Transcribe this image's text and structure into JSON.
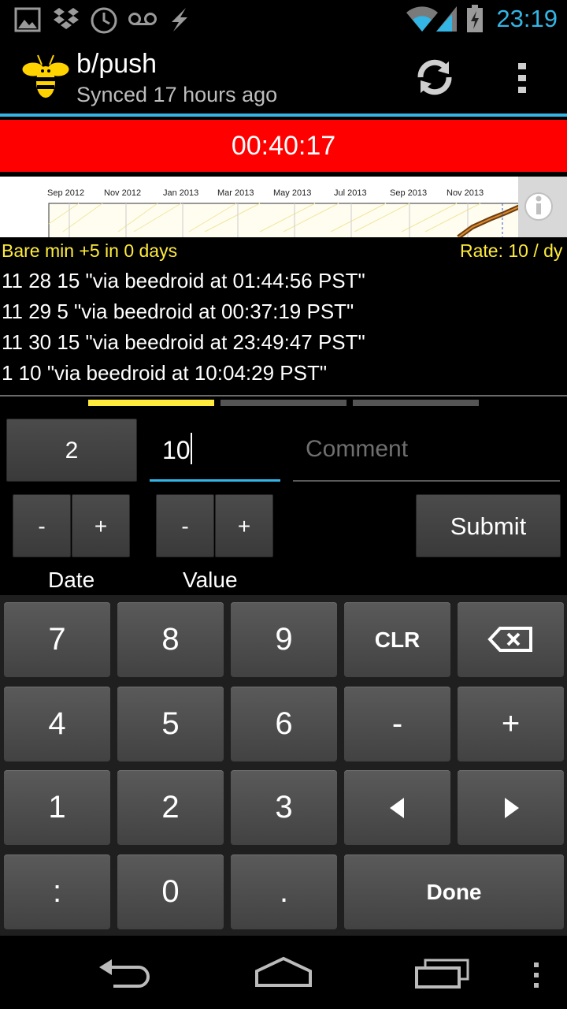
{
  "status_bar": {
    "time": "23:19",
    "icons": [
      "gallery-icon",
      "dropbox-icon",
      "clock-icon",
      "voicemail-icon",
      "lightning-icon",
      "wifi-icon",
      "signal-icon",
      "battery-icon"
    ]
  },
  "app_bar": {
    "title": "b/push",
    "subtitle": "Synced 17 hours ago",
    "icons": [
      "bee-logo-icon",
      "sync-icon",
      "overflow-menu-icon"
    ]
  },
  "timer": {
    "text": "00:40:17",
    "color": "#ff0000"
  },
  "graph": {
    "month_labels": [
      "Sep 2012",
      "Nov 2012",
      "Jan 2013",
      "Mar 2013",
      "May 2013",
      "Jul 2013",
      "Sep 2013",
      "Nov 2013"
    ]
  },
  "info": {
    "bare_min": "Bare min +5 in 0 days",
    "rate": "Rate: 10 / dy"
  },
  "datapoints": [
    "11 28 15 \"via beedroid at 01:44:56 PST\"",
    "11 29 5 \"via beedroid at 00:37:19 PST\"",
    "11 30 15 \"via beedroid at 23:49:47 PST\"",
    "1 10 \"via beedroid at 10:04:29 PST\""
  ],
  "entry": {
    "date_value": "2",
    "value_value": "10",
    "comment_placeholder": "Comment",
    "minus": "-",
    "plus": "+",
    "submit": "Submit",
    "date_label": "Date",
    "value_label": "Value"
  },
  "keypad": {
    "k7": "7",
    "k8": "8",
    "k9": "9",
    "clr": "CLR",
    "k4": "4",
    "k5": "5",
    "k6": "6",
    "minus": "-",
    "plus": "+",
    "k1": "1",
    "k2": "2",
    "k3": "3",
    "colon": ":",
    "k0": "0",
    "dot": ".",
    "done": "Done"
  },
  "colors": {
    "accent": "#33b5e5",
    "yellow": "#ffeb3b"
  }
}
